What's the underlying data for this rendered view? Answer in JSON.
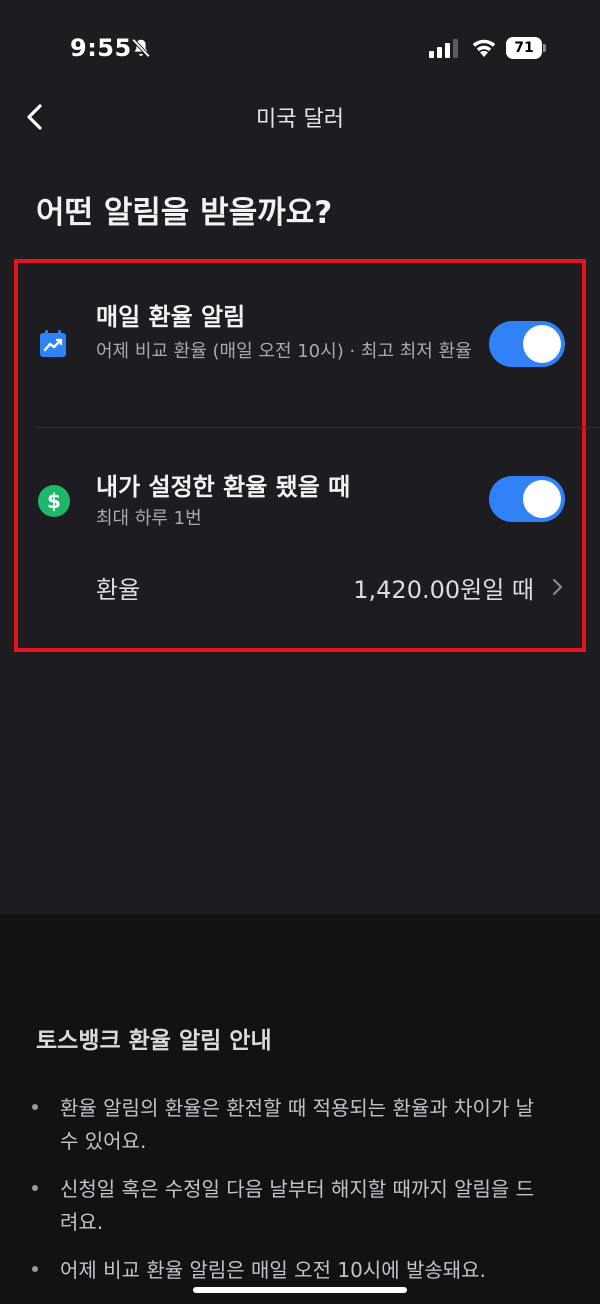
{
  "status_bar": {
    "time": "9:55",
    "battery": "71",
    "icons": [
      "bell-off-icon",
      "signal-icon",
      "wifi-icon",
      "battery-icon"
    ]
  },
  "nav": {
    "title": "미국 달러",
    "back_icon": "chevron-left-icon"
  },
  "headline": "어떤 알림을 받을까요?",
  "settings": [
    {
      "icon": "calendar-chart-icon",
      "title": "매일 환율 알림",
      "subtitle": "어제 비교 환율 (매일 오전 10시) · 최고 최저 환율",
      "enabled": true
    },
    {
      "icon": "dollar-circle-icon",
      "title": "내가 설정한 환율 됐을 때",
      "subtitle": "최대 하루 1번",
      "enabled": true
    }
  ],
  "rate": {
    "label": "환율",
    "value": "1,420.00원일 때"
  },
  "info": {
    "title": "토스뱅크 환율 알림 안내",
    "items": [
      "환율 알림의 환율은 환전할 때 적용되는 환율과 차이가 날 수 있어요.",
      "신청일 혹은 수정일 다음 날부터 해지할 때까지 알림을 드려요.",
      "어제 비교 환율 알림은 매일 오전 10시에 발송돼요."
    ]
  },
  "colors": {
    "background": "#1c1c21",
    "accent": "#3182f6",
    "highlight": "#e3141b",
    "dollar_icon": "#1fb86a"
  }
}
